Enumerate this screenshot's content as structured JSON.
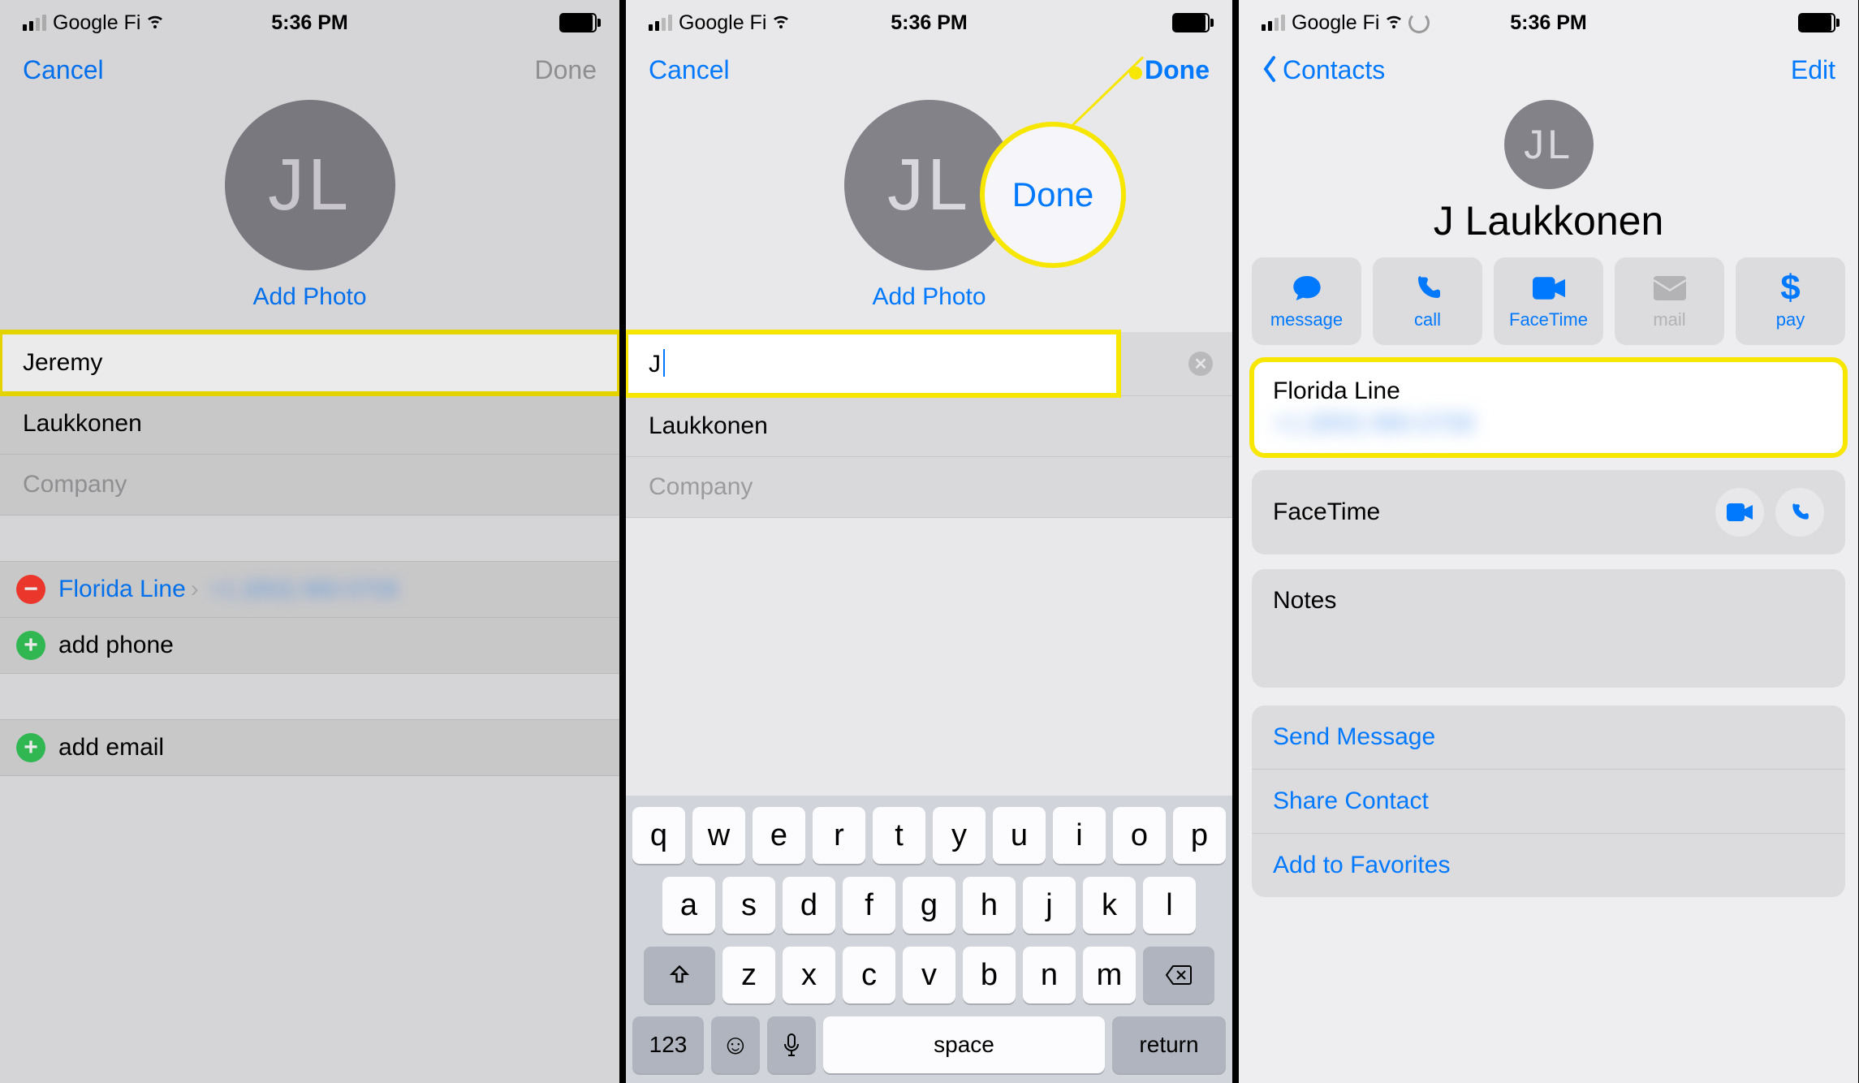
{
  "status": {
    "carrier": "Google Fi",
    "time": "5:36 PM"
  },
  "panel1": {
    "cancel": "Cancel",
    "done": "Done",
    "initials": "JL",
    "add_photo": "Add Photo",
    "first_name": "Jeremy",
    "last_name": "Laukkonen",
    "company_ph": "Company",
    "phone_label": "Florida Line",
    "phone_blur": "+1 (850) 980-0708",
    "add_phone": "add phone",
    "add_email": "add email"
  },
  "panel2": {
    "cancel": "Cancel",
    "done": "Done",
    "callout": "Done",
    "initials": "JL",
    "add_photo": "Add Photo",
    "first_name": "J",
    "last_name": "Laukkonen",
    "company_ph": "Company",
    "keys_r1": [
      "q",
      "w",
      "e",
      "r",
      "t",
      "y",
      "u",
      "i",
      "o",
      "p"
    ],
    "keys_r2": [
      "a",
      "s",
      "d",
      "f",
      "g",
      "h",
      "j",
      "k",
      "l"
    ],
    "keys_r3": [
      "z",
      "x",
      "c",
      "v",
      "b",
      "n",
      "m"
    ],
    "num": "123",
    "space": "space",
    "return": "return"
  },
  "panel3": {
    "back": "Contacts",
    "edit": "Edit",
    "initials": "JL",
    "full_name": "J Laukkonen",
    "actions": [
      {
        "label": "message",
        "icon": "message"
      },
      {
        "label": "call",
        "icon": "call"
      },
      {
        "label": "FaceTime",
        "icon": "facetime"
      },
      {
        "label": "mail",
        "icon": "mail",
        "disabled": true
      },
      {
        "label": "pay",
        "icon": "pay"
      }
    ],
    "phone_label": "Florida Line",
    "phone_blur": "+1 (850) 980-0708",
    "facetime": "FaceTime",
    "notes": "Notes",
    "links": [
      "Send Message",
      "Share Contact",
      "Add to Favorites"
    ]
  }
}
